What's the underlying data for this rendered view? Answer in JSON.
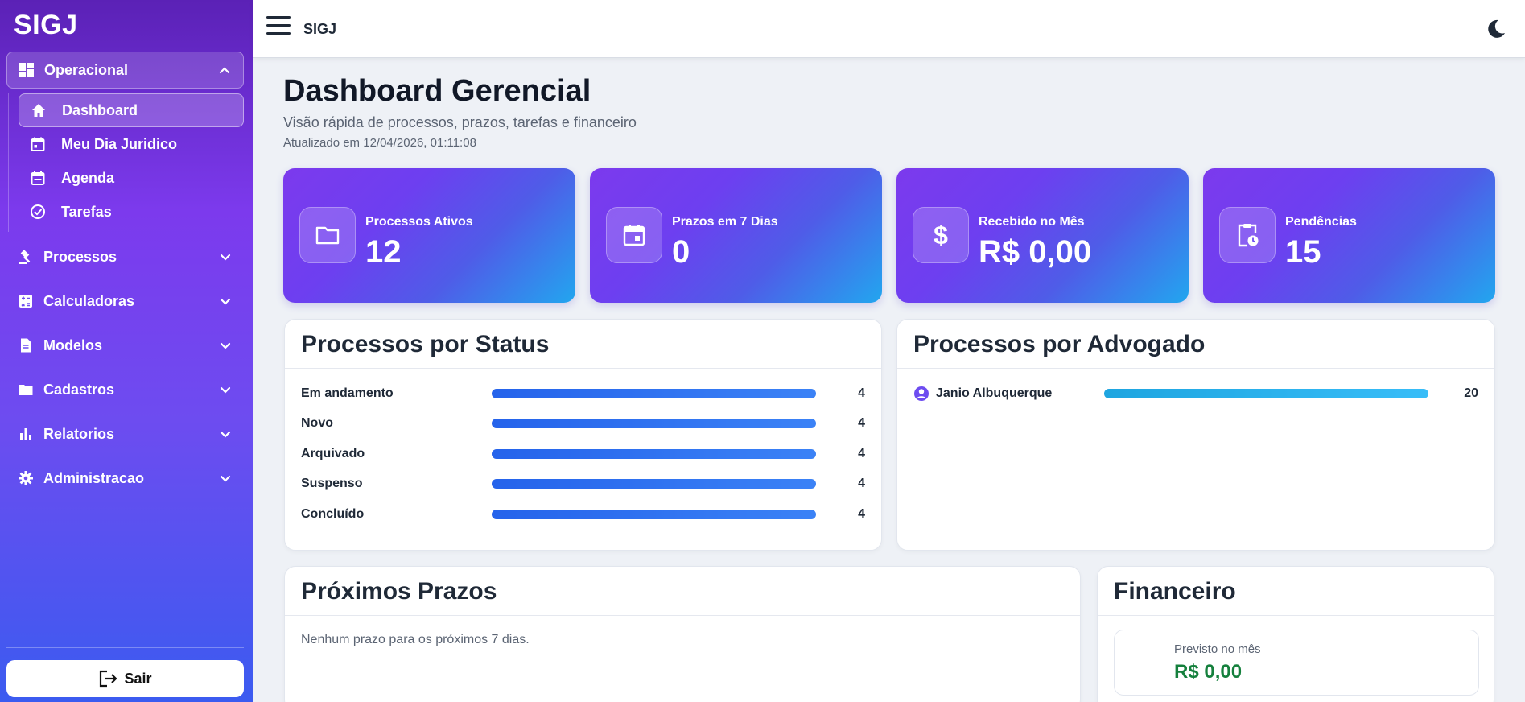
{
  "app": {
    "brand": "SIGJ",
    "top_title": "SIGJ"
  },
  "sidebar": {
    "groups": [
      {
        "label": "Operacional",
        "icon": "dashboard-grid-icon",
        "expanded": true
      },
      {
        "label": "Processos",
        "icon": "gavel-icon"
      },
      {
        "label": "Calculadoras",
        "icon": "calculator-icon"
      },
      {
        "label": "Modelos",
        "icon": "document-icon"
      },
      {
        "label": "Cadastros",
        "icon": "folder-icon"
      },
      {
        "label": "Relatorios",
        "icon": "bar-chart-icon"
      },
      {
        "label": "Administracao",
        "icon": "gear-icon"
      }
    ],
    "sub_items": [
      {
        "label": "Dashboard",
        "icon": "home-icon",
        "active": true
      },
      {
        "label": "Meu Dia Juridico",
        "icon": "calendar-icon"
      },
      {
        "label": "Agenda",
        "icon": "calendar-icon"
      },
      {
        "label": "Tarefas",
        "icon": "check-circle-icon"
      }
    ],
    "logout_label": "Sair"
  },
  "page": {
    "title": "Dashboard Gerencial",
    "subtitle": "Visão rápida de processos, prazos, tarefas e financeiro",
    "updated": "Atualizado em 12/04/2026, 01:11:08"
  },
  "kpis": [
    {
      "label": "Processos Ativos",
      "value": "12",
      "icon": "folder-icon"
    },
    {
      "label": "Prazos em 7 Dias",
      "value": "0",
      "icon": "calendar-icon"
    },
    {
      "label": "Recebido no Mês",
      "value": "R$ 0,00",
      "icon": "dollar-icon"
    },
    {
      "label": "Pendências",
      "value": "15",
      "icon": "clipboard-clock-icon"
    }
  ],
  "status_card": {
    "title": "Processos por Status",
    "rows": [
      {
        "label": "Em andamento",
        "count": "4",
        "fraction": 1.0
      },
      {
        "label": "Novo",
        "count": "4",
        "fraction": 1.0
      },
      {
        "label": "Arquivado",
        "count": "4",
        "fraction": 1.0
      },
      {
        "label": "Suspenso",
        "count": "4",
        "fraction": 1.0
      },
      {
        "label": "Concluído",
        "count": "4",
        "fraction": 1.0
      }
    ]
  },
  "lawyer_card": {
    "title": "Processos por Advogado",
    "rows": [
      {
        "label": "Janio Albuquerque",
        "count": "20",
        "fraction": 1.0
      }
    ]
  },
  "deadlines_card": {
    "title": "Próximos Prazos",
    "empty": "Nenhum prazo para os próximos 7 dias."
  },
  "finance_card": {
    "title": "Financeiro",
    "label": "Previsto no mês",
    "value": "R$ 0,00"
  },
  "colors": {
    "accent": "#7c3aed",
    "bar_blue": "#2563eb",
    "bar_cyan": "#1ea5e0",
    "money_green": "#15803d"
  }
}
